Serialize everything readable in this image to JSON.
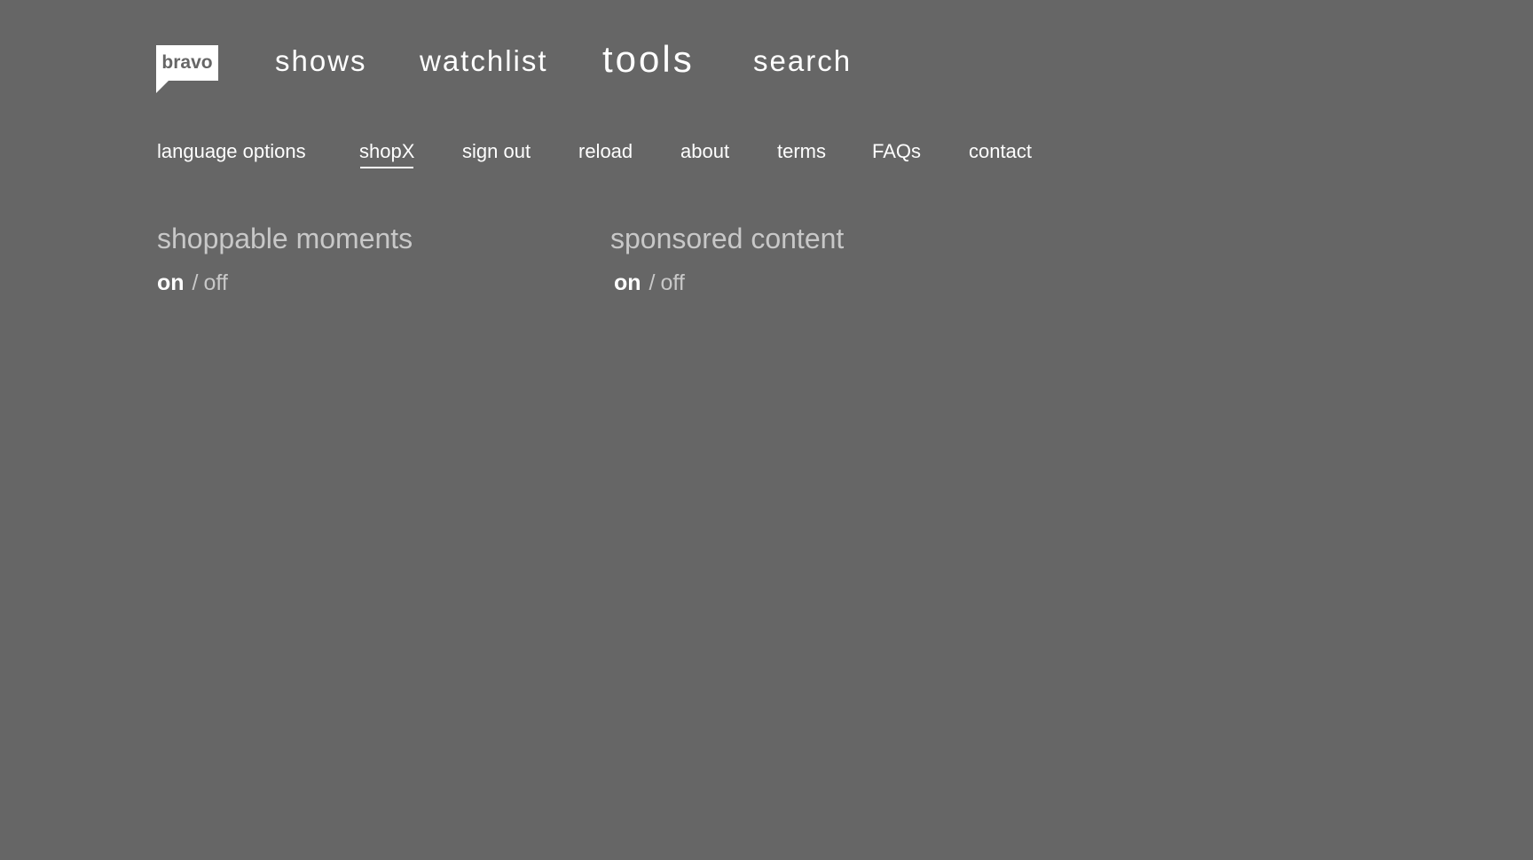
{
  "logo": {
    "text": "bravo"
  },
  "topnav": {
    "shows": "shows",
    "watchlist": "watchlist",
    "tools": "tools",
    "search": "search"
  },
  "subnav": {
    "language_options": "language options",
    "shopx": "shopX",
    "sign_out": "sign out",
    "reload": "reload",
    "about": "about",
    "terms": "terms",
    "faqs": "FAQs",
    "contact": "contact"
  },
  "settings": {
    "shoppable_moments": {
      "title": "shoppable moments",
      "on": "on",
      "separator": "/",
      "off": "off",
      "selected": "on"
    },
    "sponsored_content": {
      "title": "sponsored content",
      "on": "on",
      "separator": "/",
      "off": "off",
      "selected": "on"
    }
  },
  "colors": {
    "background": "#666666",
    "text": "#ffffff",
    "muted": "#c8c8c8"
  }
}
